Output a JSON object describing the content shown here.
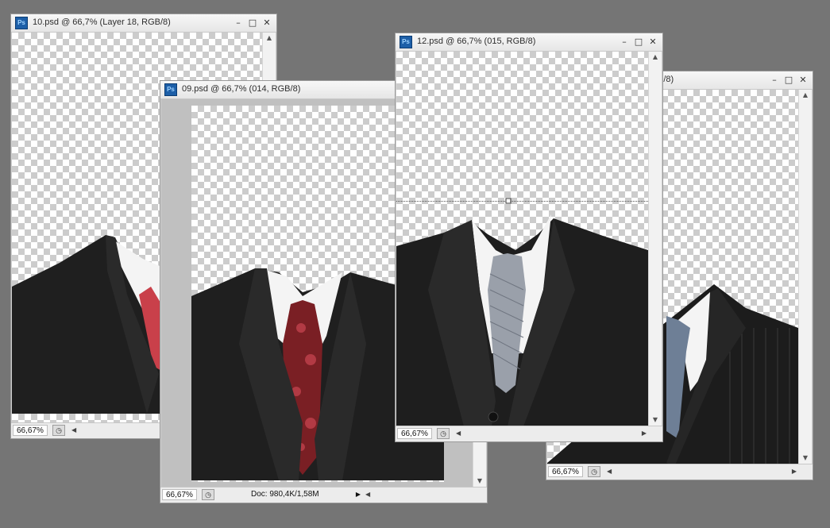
{
  "colors": {
    "workspace": "#757575",
    "jacket": "#1f1f1f",
    "shirt": "#f4f4f4",
    "tie_red": "#c9404a",
    "tie_paisley": "#7a1f24",
    "tie_silver": "#9aa0aa",
    "tie_blue": "#6e7f96",
    "ps_icon": "#1d5fa8"
  },
  "windows": [
    {
      "id": "win10",
      "app_icon": "Ps",
      "title": "10.psd @ 66,7% (Layer 18, RGB/8)",
      "zoom": "66,67%",
      "buttons": {
        "minimize": "–",
        "maximize": "□",
        "close": "✕"
      },
      "tie_icon": "red-tie"
    },
    {
      "id": "win09",
      "app_icon": "Ps",
      "title": "09.psd @ 66,7% (014, RGB/8)",
      "zoom": "66,67%",
      "doc_info": "Doc: 980,4K/1,58M",
      "buttons": {
        "minimize": "–",
        "maximize": "□",
        "close": "✕"
      },
      "tie_icon": "paisley-tie"
    },
    {
      "id": "win12",
      "app_icon": "Ps",
      "title": "12.psd @ 66,7% (015, RGB/8)",
      "zoom": "66,67%",
      "buttons": {
        "minimize": "–",
        "maximize": "□",
        "close": "✕"
      },
      "tie_icon": "silver-tie"
    },
    {
      "id": "win11",
      "app_icon": "Ps",
      "title": "B/8)",
      "zoom": "66,67%",
      "buttons": {
        "minimize": "–",
        "maximize": "□",
        "close": "✕"
      },
      "tie_icon": "blue-tie"
    }
  ]
}
